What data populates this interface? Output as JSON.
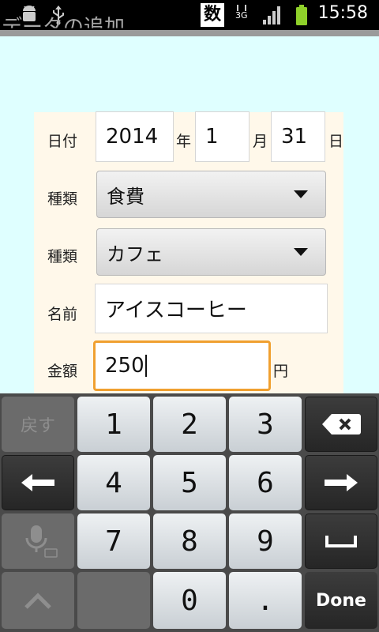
{
  "status_bar": {
    "ime_indicator": "数",
    "network_label": "3G",
    "time": "15:58"
  },
  "title": "データの追加",
  "form": {
    "date_label": "日付",
    "year_value": "2014",
    "year_unit": "年",
    "month_value": "1",
    "month_unit": "月",
    "day_value": "31",
    "day_unit": "日",
    "category_label": "種類",
    "category_value": "食費",
    "subcategory_label": "種類",
    "subcategory_value": "カフェ",
    "name_label": "名前",
    "name_value": "アイスコーヒー",
    "amount_label": "金額",
    "amount_value": "250",
    "amount_unit": "円"
  },
  "keyboard": {
    "undo_label": "戻す",
    "keys": [
      "1",
      "2",
      "3",
      "4",
      "5",
      "6",
      "7",
      "8",
      "9",
      "0",
      "."
    ],
    "done_label": "Done"
  },
  "colors": {
    "background": "#dfffff",
    "form_background": "#fff8ea",
    "focus_border": "#f0a030"
  }
}
